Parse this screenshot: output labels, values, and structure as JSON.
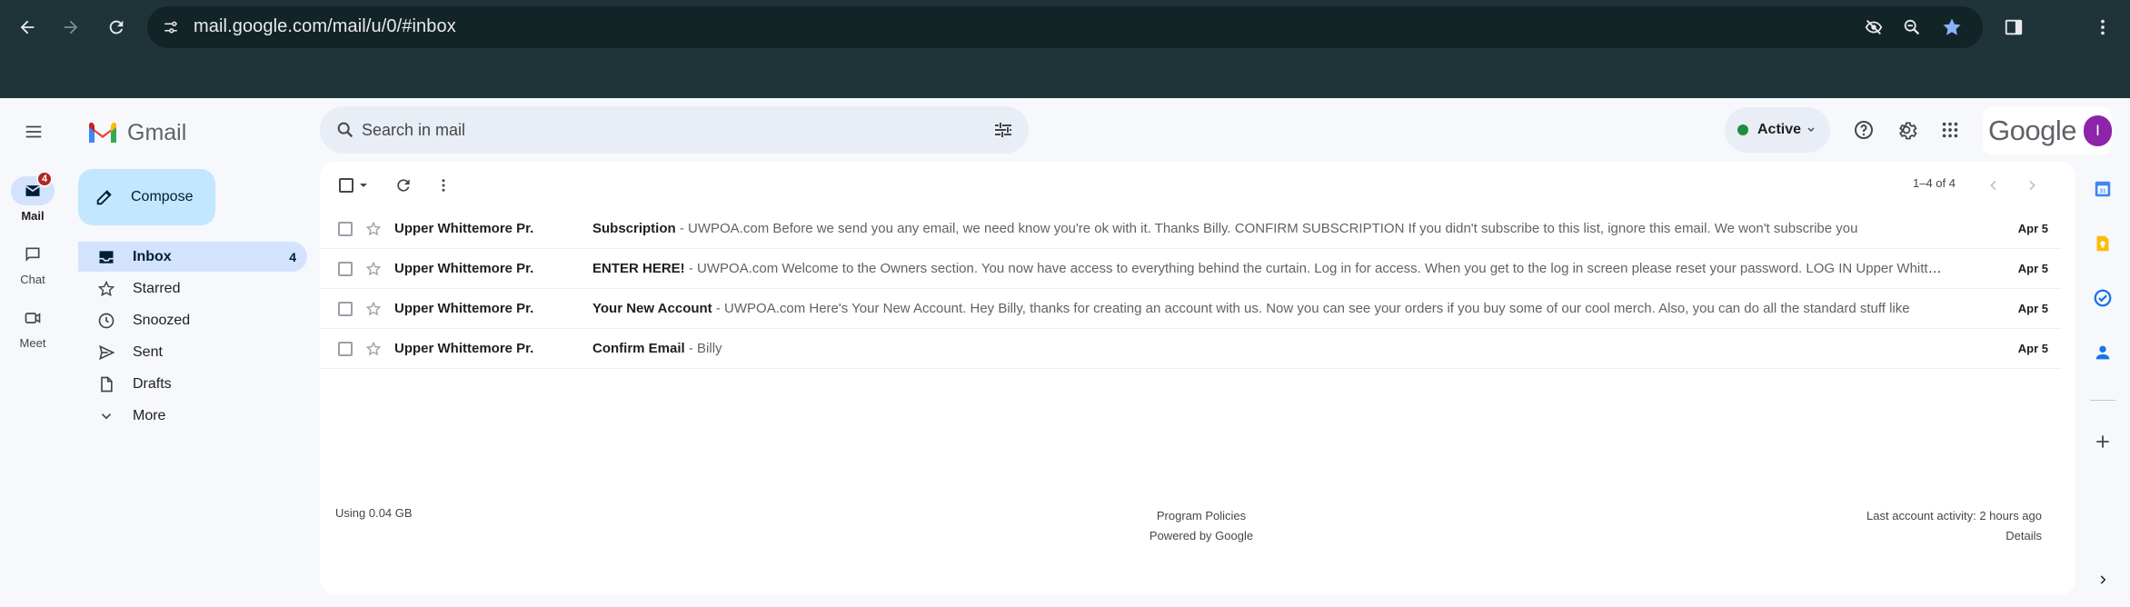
{
  "browser": {
    "url": "mail.google.com/mail/u/0/#inbox"
  },
  "app": {
    "logo_text": "Gmail",
    "search_placeholder": "Search in mail",
    "status_label": "Active",
    "brand_text": "Google",
    "avatar_initial": "I"
  },
  "rail": [
    {
      "label": "Mail",
      "badge": "4",
      "icon": "mail-icon"
    },
    {
      "label": "Chat",
      "icon": "chat-icon"
    },
    {
      "label": "Meet",
      "icon": "meet-icon"
    }
  ],
  "compose_label": "Compose",
  "nav": [
    {
      "label": "Inbox",
      "count": "4",
      "icon": "inbox-icon"
    },
    {
      "label": "Starred",
      "icon": "star-icon"
    },
    {
      "label": "Snoozed",
      "icon": "clock-icon"
    },
    {
      "label": "Sent",
      "icon": "send-icon"
    },
    {
      "label": "Drafts",
      "icon": "draft-icon"
    },
    {
      "label": "More",
      "icon": "chevron-down-icon"
    }
  ],
  "pagination": "1–4 of 4",
  "emails": [
    {
      "sender": "Upper Whittemore Pr.",
      "subject": "Subscription",
      "snippet": "UWPOA.com Before we send you any email, we need know you're ok with it. Thanks Billy. CONFIRM SUBSCRIPTION If you didn't subscribe to this list, ignore this email. We won't subscribe you",
      "date": "Apr 5"
    },
    {
      "sender": "Upper Whittemore Pr.",
      "subject": "ENTER HERE!",
      "snippet": "UWPOA.com Welcome to the Owners section. You now have access to everything behind the curtain. Log in for access. When you get to the log in screen please reset your password. LOG IN Upper Whittemore Pond Owners Association",
      "date": "Apr 5"
    },
    {
      "sender": "Upper Whittemore Pr.",
      "subject": "Your New Account",
      "snippet": "UWPOA.com Here's Your New Account. Hey Billy, thanks for creating an account with us. Now you can see your orders if you buy some of our cool merch. Also, you can do all the standard stuff like",
      "date": "Apr 5"
    },
    {
      "sender": "Upper Whittemore Pr.",
      "subject": "Confirm Email",
      "snippet": "Billy",
      "date": "Apr 5"
    }
  ],
  "subject_separator": " - ",
  "footer": {
    "storage": "Using 0.04 GB",
    "program_policies": "Program Policies",
    "powered_by": "Powered by Google",
    "last_activity": "Last account activity: 2 hours ago",
    "details": "Details"
  },
  "colors": {
    "compose_bg": "#c2e7ff",
    "selected_nav_bg": "#d3e3fd",
    "active_status": "#1e8e3e",
    "badge": "#b3261e",
    "avatar": "#8e24aa"
  }
}
